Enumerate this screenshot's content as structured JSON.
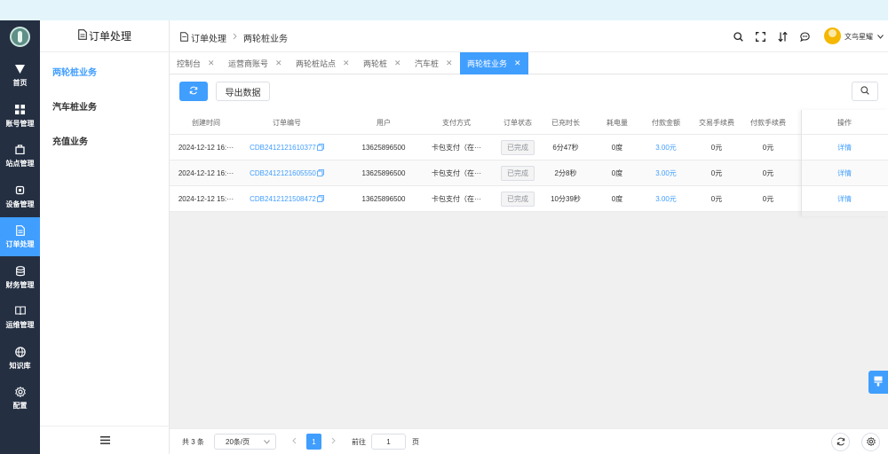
{
  "rail": {
    "items": [
      {
        "label": "首页",
        "icon": "home-icon"
      },
      {
        "label": "账号管理",
        "icon": "grid-icon"
      },
      {
        "label": "站点管理",
        "icon": "store-icon"
      },
      {
        "label": "设备管理",
        "icon": "chip-icon"
      },
      {
        "label": "订单处理",
        "icon": "document-icon",
        "active": true
      },
      {
        "label": "财务管理",
        "icon": "database-icon"
      },
      {
        "label": "运维管理",
        "icon": "book-icon"
      },
      {
        "label": "知识库",
        "icon": "globe-icon"
      },
      {
        "label": "配置",
        "icon": "gear-icon"
      }
    ]
  },
  "submenu": {
    "title": "订单处理",
    "items": [
      "两轮桩业务",
      "汽车桩业务",
      "充值业务"
    ],
    "active_index": 0
  },
  "header": {
    "breadcrumb": [
      "订单处理",
      "两轮桩业务"
    ],
    "icons": [
      "search-icon",
      "fullscreen-icon",
      "translate-icon",
      "message-icon"
    ],
    "user_name": "文鸟星耀"
  },
  "tabs": [
    {
      "label": "控制台"
    },
    {
      "label": "运营商账号"
    },
    {
      "label": "两轮桩站点"
    },
    {
      "label": "两轮桩"
    },
    {
      "label": "汽车桩"
    },
    {
      "label": "两轮桩业务",
      "active": true
    }
  ],
  "toolbar": {
    "export_label": "导出数据"
  },
  "table": {
    "columns": [
      "创建时间",
      "订单编号",
      "用户",
      "支付方式",
      "订单状态",
      "已充时长",
      "耗电量",
      "付款金额",
      "交易手续费",
      "付款手续费",
      "操作"
    ],
    "rows": [
      {
        "created": "2024-12-12 16:···",
        "order_no": "CDB2412121610377",
        "user": "13625896500",
        "pay_method": "卡包支付（在···",
        "status": "已完成",
        "duration": "6分47秒",
        "energy": "0度",
        "amount": "3.00元",
        "txn_fee": "0元",
        "pay_fee": "0元",
        "action": "详情"
      },
      {
        "created": "2024-12-12 16:···",
        "order_no": "CDB2412121605550",
        "user": "13625896500",
        "pay_method": "卡包支付（在···",
        "status": "已完成",
        "duration": "2分8秒",
        "energy": "0度",
        "amount": "3.00元",
        "txn_fee": "0元",
        "pay_fee": "0元",
        "action": "详情"
      },
      {
        "created": "2024-12-12 15:···",
        "order_no": "CDB2412121508472",
        "user": "13625896500",
        "pay_method": "卡包支付（在···",
        "status": "已完成",
        "duration": "10分39秒",
        "energy": "0度",
        "amount": "3.00元",
        "txn_fee": "0元",
        "pay_fee": "0元",
        "action": "详情"
      }
    ]
  },
  "pagination": {
    "total_text": "共 3 条",
    "page_size": "20条/页",
    "current_page": "1",
    "goto_label": "前往",
    "goto_value": "1",
    "page_unit": "页"
  },
  "colors": {
    "accent": "#409eff",
    "rail_bg": "#242f42",
    "top_band": "#e3f4fb"
  }
}
